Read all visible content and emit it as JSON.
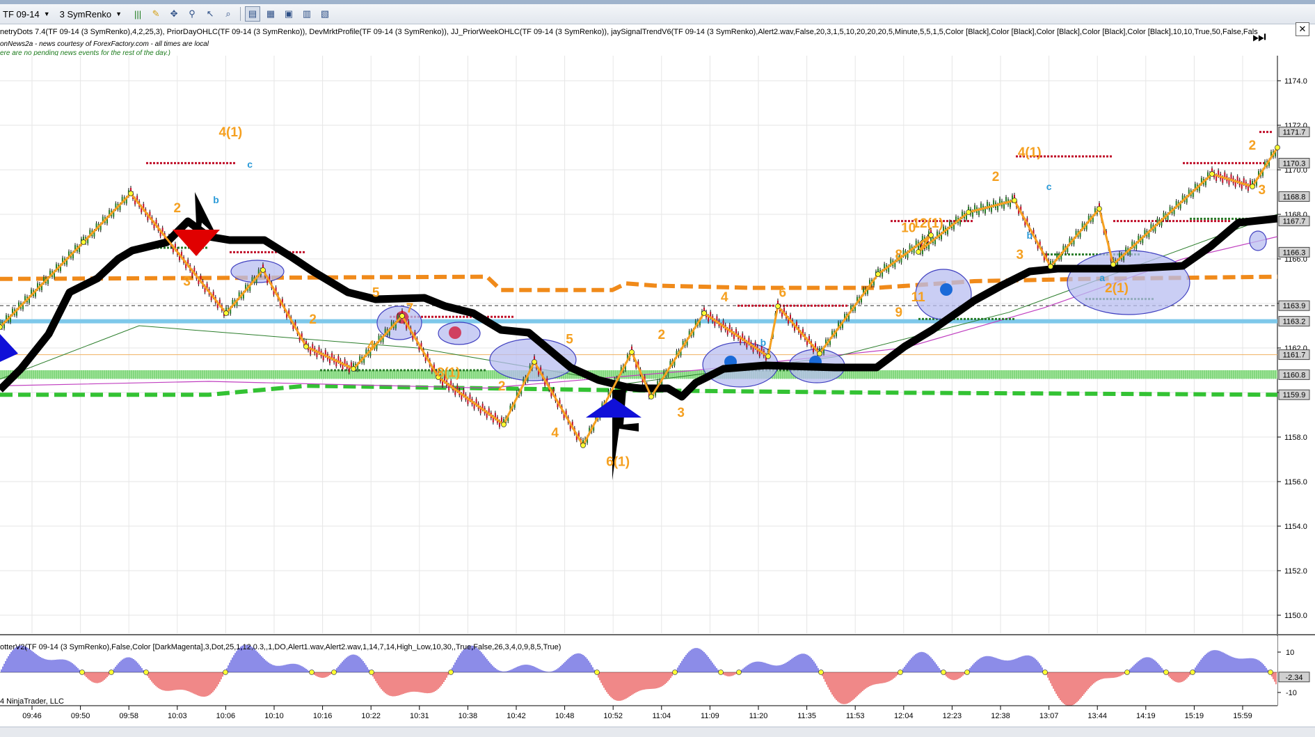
{
  "window": {
    "title": "TF 09-14 (3 SymRenko)"
  },
  "toolbar": {
    "instrument": "TF 09-14",
    "bar_type": "3 SymRenko",
    "icons": [
      "bar-style-icon",
      "drawing-pencil-icon",
      "crosshair-icon",
      "zoom-icon",
      "cursor-icon",
      "properties-icon",
      "data-box-icon",
      "indicators-icon",
      "strategies-icon",
      "chart-trader-icon",
      "window-icon"
    ]
  },
  "header": {
    "indicators": "netryDots 7.4(TF 09-14 (3 SymRenko),4,2,25,3), PriorDayOHLC(TF 09-14 (3 SymRenko)), DevMrktProfile(TF 09-14 (3 SymRenko)), JJ_PriorWeekOHLC(TF 09-14 (3 SymRenko)), jaySignalTrendV6(TF 09-14 (3 SymRenko),Alert2.wav,False,20,3,1,5,10,20,20,20,5,Minute,5,5,1,5,Color [Black],Color [Black],Color [Black],Color [Black],Color [Black],10,10,True,50,False,Fals",
    "news_line1": "onNews2a - news courtesy of ForexFactory.com - all times are local",
    "news_line2": "ere are no pending news events for the rest of the day.)"
  },
  "price_axis": {
    "ticks": [
      "1174.0",
      "1172.0",
      "1170.0",
      "1168.0",
      "1166.0",
      "1164.0",
      "1162.0",
      "1160.0",
      "1158.0",
      "1156.0",
      "1154.0",
      "1152.0",
      "1150.0"
    ],
    "tick_values": [
      1174,
      1172,
      1170,
      1168,
      1166,
      1164,
      1162,
      1160,
      1158,
      1156,
      1154,
      1152,
      1150
    ],
    "badges": [
      {
        "label": "1171.7",
        "value": 1171.7,
        "color": "#d0d0d0"
      },
      {
        "label": "1170.3",
        "value": 1170.3,
        "color": "#d0d0d0"
      },
      {
        "label": "1168.8",
        "value": 1168.8,
        "color": "#d0d0d0"
      },
      {
        "label": "1167.7",
        "value": 1167.7,
        "color": "#d0d0d0"
      },
      {
        "label": "1166.3",
        "value": 1166.3,
        "color": "#d0d0d0"
      },
      {
        "label": "1163.9",
        "value": 1163.9,
        "color": "#d0d0d0"
      },
      {
        "label": "1163.2",
        "value": 1163.2,
        "color": "#d0d0d0"
      },
      {
        "label": "1161.7",
        "value": 1161.7,
        "color": "#d0d0d0"
      },
      {
        "label": "1160.8",
        "value": 1160.8,
        "color": "#d0d0d0"
      },
      {
        "label": "1159.9",
        "value": 1159.9,
        "color": "#d0d0d0"
      }
    ]
  },
  "time_axis": {
    "labels": [
      "09:46",
      "09:50",
      "09:58",
      "10:03",
      "10:06",
      "10:10",
      "10:16",
      "10:22",
      "10:31",
      "10:38",
      "10:42",
      "10:48",
      "10:52",
      "11:04",
      "11:09",
      "11:20",
      "11:35",
      "11:53",
      "12:04",
      "12:23",
      "12:38",
      "13:07",
      "13:44",
      "14:19",
      "15:19",
      "15:59"
    ]
  },
  "wave_labels": [
    {
      "text": "4(1)",
      "x": 4.1,
      "price": 1171.5
    },
    {
      "text": "2",
      "x": 3,
      "price": 1168.1
    },
    {
      "text": "3",
      "x": 3.2,
      "price": 1164.8
    },
    {
      "text": "2",
      "x": 5.8,
      "price": 1163.1
    },
    {
      "text": "5",
      "x": 7.1,
      "price": 1164.3
    },
    {
      "text": "7",
      "x": 7.8,
      "price": 1163.6
    },
    {
      "text": "4",
      "x": 7,
      "price": 1161.9
    },
    {
      "text": "8(1)",
      "x": 8.6,
      "price": 1160.7
    },
    {
      "text": "2",
      "x": 9.7,
      "price": 1160.1
    },
    {
      "text": "5",
      "x": 11.1,
      "price": 1162.2
    },
    {
      "text": "4",
      "x": 10.8,
      "price": 1158.0
    },
    {
      "text": "6(1)",
      "x": 12.1,
      "price": 1156.7
    },
    {
      "text": "2",
      "x": 13,
      "price": 1162.4
    },
    {
      "text": "3",
      "x": 13.4,
      "price": 1158.9
    },
    {
      "text": "4",
      "x": 14.3,
      "price": 1164.1
    },
    {
      "text": "6",
      "x": 15.5,
      "price": 1164.3
    },
    {
      "text": "8",
      "x": 17.9,
      "price": 1166.0
    },
    {
      "text": "10",
      "x": 18.1,
      "price": 1167.2
    },
    {
      "text": "12(1)",
      "x": 18.5,
      "price": 1167.4
    },
    {
      "text": "11",
      "x": 18.3,
      "price": 1164.1
    },
    {
      "text": "9",
      "x": 17.9,
      "price": 1163.4
    },
    {
      "text": "2",
      "x": 19.9,
      "price": 1169.5
    },
    {
      "text": "4(1)",
      "x": 20.6,
      "price": 1170.6
    },
    {
      "text": "3",
      "x": 20.4,
      "price": 1166.0
    },
    {
      "text": "2",
      "x": 25.2,
      "price": 1170.9
    },
    {
      "text": "3",
      "x": 25.4,
      "price": 1168.9
    },
    {
      "text": "2(1)",
      "x": 22.4,
      "price": 1164.5
    }
  ],
  "abc_labels": [
    {
      "text": "c",
      "x": 4.5,
      "price": 1170.1
    },
    {
      "text": "b",
      "x": 3.8,
      "price": 1168.5
    },
    {
      "text": "c",
      "x": 21,
      "price": 1169.1
    },
    {
      "text": "b",
      "x": 20.6,
      "price": 1166.9
    },
    {
      "text": "b",
      "x": 15.1,
      "price": 1162.1
    },
    {
      "text": "a",
      "x": 22.1,
      "price": 1165.0
    }
  ],
  "oscillator": {
    "label": "otterV2(TF 09-14 (3 SymRenko),False,Color [DarkMagenta],3,Dot,25,1,12,0.3,,1,DO,Alert1.wav,Alert2.wav,1,14,7,14,High_Low,10,30,,True,False,26,3,4,0,9,8,5,True)",
    "ticks": [
      "10",
      "-10"
    ],
    "tick_values": [
      10,
      -10
    ],
    "current_label": "-2.34",
    "current_value": -2.34
  },
  "footer": {
    "copyright": "4 NinjaTrader, LLC"
  },
  "colors": {
    "orange_wave": "#f5a020",
    "trend_black": "#000000",
    "resistance_orange": "#f08a1a",
    "support_green": "#33c233",
    "light_blue": "#7ec8ea",
    "bull_bar": "#2a7d2a",
    "bear_bar": "#c0102a",
    "osc_up": "#1a1ad0",
    "osc_down": "#e01010",
    "arrow_blue": "#1010d8",
    "arrow_red": "#e00000",
    "ellipse_fill": "#b8bdf0"
  }
}
